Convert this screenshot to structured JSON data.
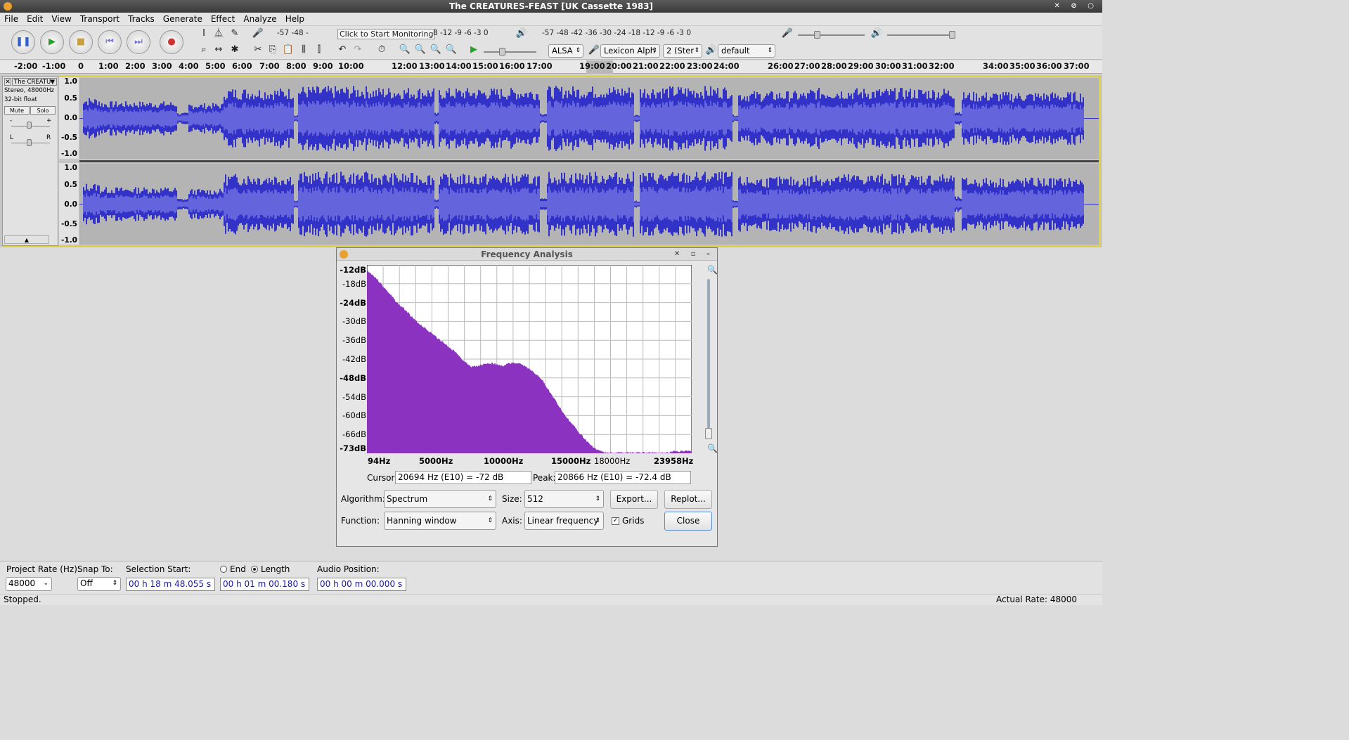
{
  "window": {
    "title": "The CREATURES-FEAST [UK Cassette 1983]"
  },
  "menu": [
    "File",
    "Edit",
    "View",
    "Transport",
    "Tracks",
    "Generate",
    "Effect",
    "Analyze",
    "Help"
  ],
  "meters": {
    "record_scale": "-57    -48    -",
    "monitor_prompt": "Click to Start Monitoring",
    "record_scale_tail": "8   -12 -9  -6  -3 0",
    "play_scale": "-57    -48    -42    -36    -30    -24    -18    -12 -9  -6  -3 0"
  },
  "device": {
    "host": "ALSA",
    "input": "Lexicon Alph",
    "channels": "2 (Ster",
    "output": "default"
  },
  "ruler": {
    "labels": [
      "-2:00",
      "-1:00",
      "0",
      "1:00",
      "2:00",
      "3:00",
      "4:00",
      "5:00",
      "6:00",
      "7:00",
      "8:00",
      "9:00",
      "10:00",
      "12:00",
      "13:00",
      "14:00",
      "15:00",
      "16:00",
      "17:00",
      "19:00",
      "20:00",
      "21:00",
      "22:00",
      "23:00",
      "24:00",
      "26:00",
      "27:00",
      "28:00",
      "29:00",
      "30:00",
      "31:00",
      "32:00",
      "34:00",
      "35:00",
      "36:00",
      "37:00"
    ]
  },
  "track": {
    "name": "The CREATU",
    "info1": "Stereo, 48000Hz",
    "info2": "32-bit float",
    "mute": "Mute",
    "solo": "Solo",
    "gain_minus": "-",
    "gain_plus": "+",
    "pan_l": "L",
    "pan_r": "R",
    "yaxis": [
      "1.0",
      "0.5",
      "0.0",
      "-0.5",
      "-1.0"
    ]
  },
  "freq": {
    "title": "Frequency Analysis",
    "ylabels": [
      "-12dB",
      "-18dB",
      "-24dB",
      "-30dB",
      "-36dB",
      "-42dB",
      "-48dB",
      "-54dB",
      "-60dB",
      "-66dB",
      "-73dB"
    ],
    "xlabels": [
      "94Hz",
      "5000Hz",
      "10000Hz",
      "15000Hz",
      "18000Hz",
      "23958Hz"
    ],
    "cursor_label": "Cursor:",
    "cursor_value": "20694 Hz (E10) = -72 dB",
    "peak_label": "Peak:",
    "peak_value": "20866 Hz (E10) = -72.4 dB",
    "algorithm_label": "Algorithm:",
    "algorithm": "Spectrum",
    "size_label": "Size:",
    "size": "512",
    "export": "Export...",
    "replot": "Replot...",
    "function_label": "Function:",
    "function": "Hanning window",
    "axis_label": "Axis:",
    "axis": "Linear frequency",
    "grids_label": "Grids",
    "grids_checked": true,
    "close": "Close",
    "spectrum_db": [
      -14,
      -16,
      -19,
      -22,
      -25,
      -27,
      -30,
      -32,
      -34,
      -36,
      -38,
      -40,
      -43,
      -45,
      -45,
      -44,
      -44,
      -45,
      -44,
      -44,
      -45,
      -47,
      -49,
      -53,
      -57,
      -61,
      -64,
      -67,
      -70,
      -72,
      -73,
      -73,
      -73,
      -73,
      -73,
      -73,
      -73,
      -73,
      -73,
      -72.5,
      -72.4,
      -72.2
    ]
  },
  "selection": {
    "rate_label": "Project Rate (Hz):",
    "rate": "48000",
    "snap_label": "Snap To:",
    "snap": "Off",
    "start_label": "Selection Start:",
    "end_label": "End",
    "length_label": "Length",
    "start": "00 h 18 m 48.055 s",
    "length": "00 h 01 m 00.180 s",
    "audio_pos_label": "Audio Position:",
    "audio_pos": "00 h 00 m 00.000 s"
  },
  "status": {
    "left": "Stopped.",
    "right": "Actual Rate: 48000"
  },
  "colors": {
    "wave": "#3232c8",
    "wave_rms": "#6464dc",
    "spectrum": "#8c32c0"
  }
}
